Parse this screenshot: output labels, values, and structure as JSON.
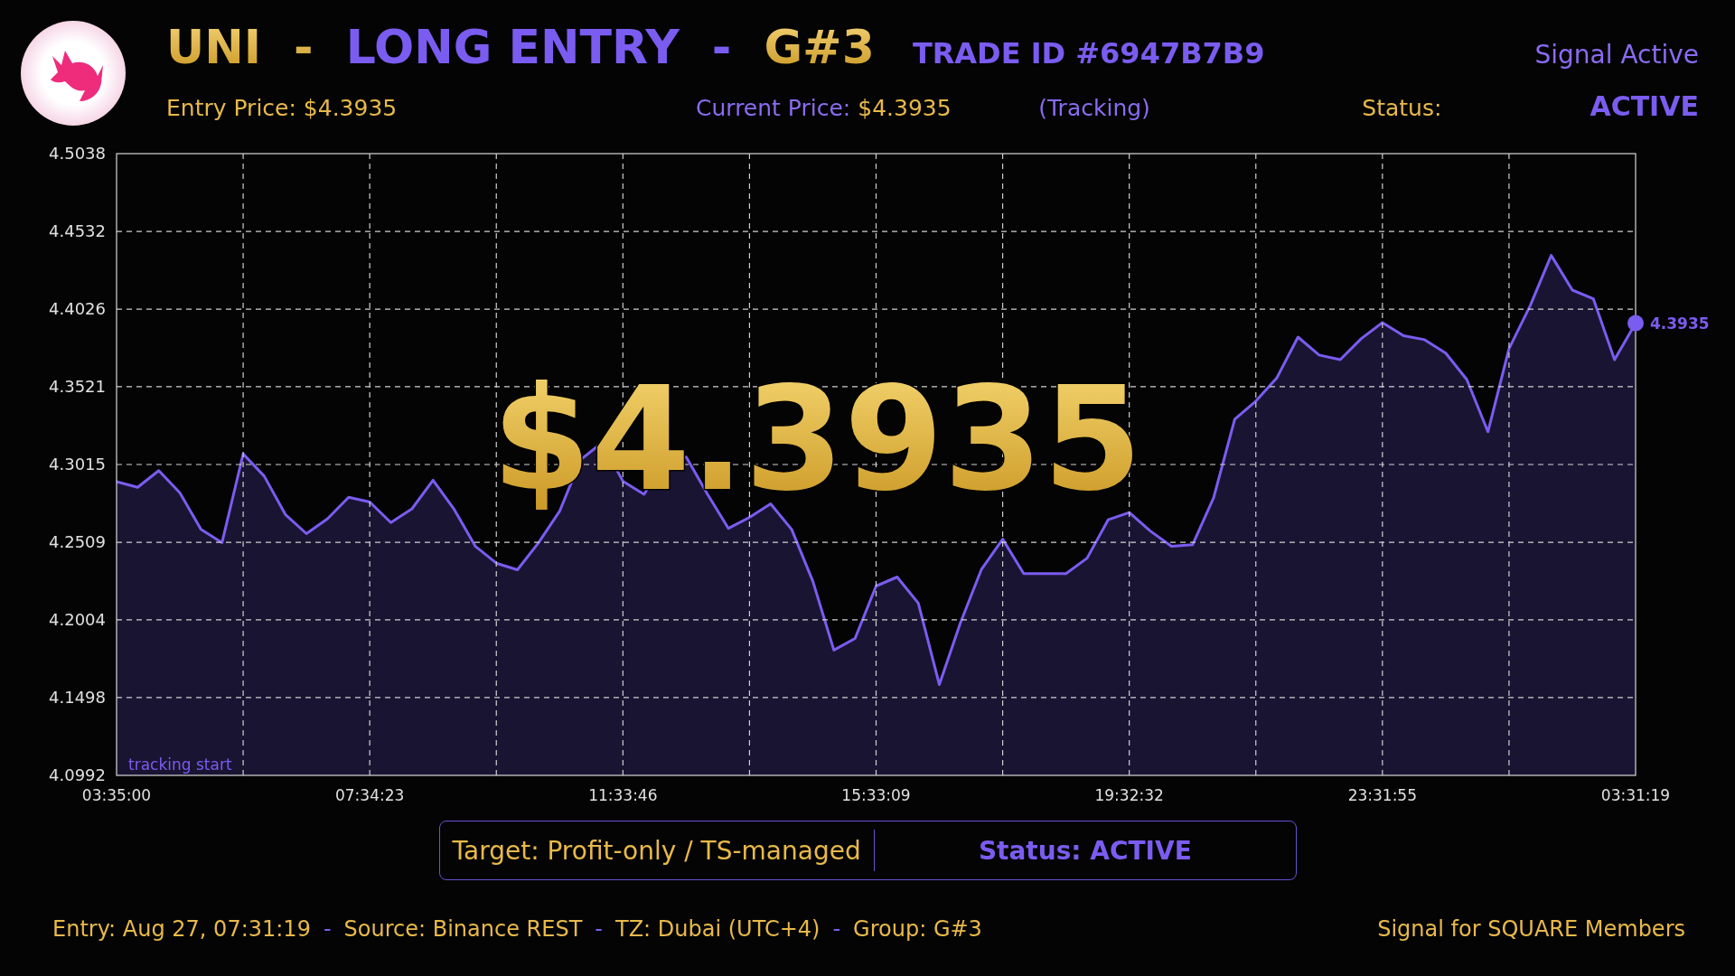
{
  "header": {
    "title": [
      {
        "text": "UNI",
        "kind": "gold"
      },
      {
        "text": "-",
        "kind": "gold"
      },
      {
        "text": "LONG ENTRY",
        "kind": "purple"
      },
      {
        "text": "-",
        "kind": "purple"
      },
      {
        "text": "G#3",
        "kind": "gold"
      }
    ],
    "trade_id": "TRADE ID #6947B7B9",
    "signal": "Signal Active",
    "entry_price": "Entry Price: $4.3935",
    "current_price_label": "Current Price:",
    "current_price": "$4.3935",
    "tracking": "(Tracking)",
    "status_label": "Status:",
    "status": "ACTIVE"
  },
  "price_display": "$4.3935",
  "chart_data": {
    "type": "area",
    "categories": [
      "03:35:00",
      null,
      null,
      null,
      null,
      null,
      null,
      null,
      null,
      null,
      null,
      null,
      "07:34:23",
      null,
      null,
      null,
      null,
      null,
      null,
      null,
      null,
      null,
      null,
      null,
      "11:33:46",
      null,
      null,
      null,
      null,
      null,
      null,
      null,
      null,
      null,
      null,
      null,
      "15:33:09",
      null,
      null,
      null,
      null,
      null,
      null,
      null,
      null,
      null,
      null,
      null,
      "19:32:32",
      null,
      null,
      null,
      null,
      null,
      null,
      null,
      null,
      null,
      null,
      null,
      "23:31:55",
      null,
      null,
      null,
      null,
      null,
      null,
      null,
      null,
      null,
      null,
      null,
      "03:31:19"
    ],
    "series": [
      {
        "color": "#7b5cf0",
        "values": [
          4.2903,
          4.2867,
          4.2975,
          4.2831,
          4.2593,
          4.2507,
          4.3084,
          4.2939,
          4.269,
          4.2565,
          4.2662,
          4.2802,
          4.2771,
          4.2637,
          4.2727,
          4.2913,
          4.2723,
          4.2484,
          4.2373,
          4.233,
          4.2506,
          4.2711,
          4.3047,
          4.3156,
          4.2907,
          4.2821,
          4.3044,
          4.3064,
          4.2824,
          4.2599,
          4.2671,
          4.2759,
          4.2592,
          4.2256,
          4.1807,
          4.1883,
          4.2224,
          4.2283,
          4.2113,
          4.1583,
          4.1986,
          4.2334,
          4.2529,
          4.2305,
          4.2305,
          4.2305,
          4.2406,
          4.2655,
          4.2702,
          4.2582,
          4.2483,
          4.2493,
          4.28,
          4.331,
          4.3428,
          4.358,
          4.3844,
          4.3727,
          4.3697,
          4.3835,
          4.3939,
          4.3853,
          4.3827,
          4.374,
          4.3568,
          4.3228,
          4.3769,
          4.4048,
          4.4376,
          4.415,
          4.4093,
          4.3697,
          4.3935
        ]
      }
    ],
    "ylim": [
      4.0992,
      4.5038
    ],
    "yticks": [
      {
        "value": 4.0992,
        "label": "4.0992"
      },
      {
        "value": 4.1498,
        "label": "4.1498"
      },
      {
        "value": 4.2004,
        "label": "4.2004"
      },
      {
        "value": 4.2509,
        "label": "4.2509"
      },
      {
        "value": 4.3015,
        "label": "4.3015"
      },
      {
        "value": 4.3521,
        "label": "4.3521"
      },
      {
        "value": 4.4026,
        "label": "4.4026"
      },
      {
        "value": 4.4532,
        "label": "4.4532"
      },
      {
        "value": 4.5038,
        "label": "4.5038"
      }
    ],
    "grid": true,
    "annotations": [
      {
        "x": "03:35:00",
        "y": 4.0992,
        "text": "tracking start"
      },
      {
        "x": "03:31:19",
        "y": 4.3935,
        "text": "4.3935"
      }
    ]
  },
  "info_box": {
    "target": "Target: Profit-only / TS-managed",
    "status": "Status: ACTIVE"
  },
  "footer": {
    "items": [
      {
        "text": "Entry: Aug 27, 07:31:19",
        "kind": "field"
      },
      {
        "text": "-",
        "kind": "separator"
      },
      {
        "text": "Source: Binance REST",
        "kind": "field"
      },
      {
        "text": "-",
        "kind": "separator"
      },
      {
        "text": "TZ: Dubai (UTC+4)",
        "kind": "field"
      },
      {
        "text": "-",
        "kind": "separator"
      },
      {
        "text": "Group: G#3",
        "kind": "field"
      }
    ],
    "note": "Signal for SQUARE Members"
  }
}
